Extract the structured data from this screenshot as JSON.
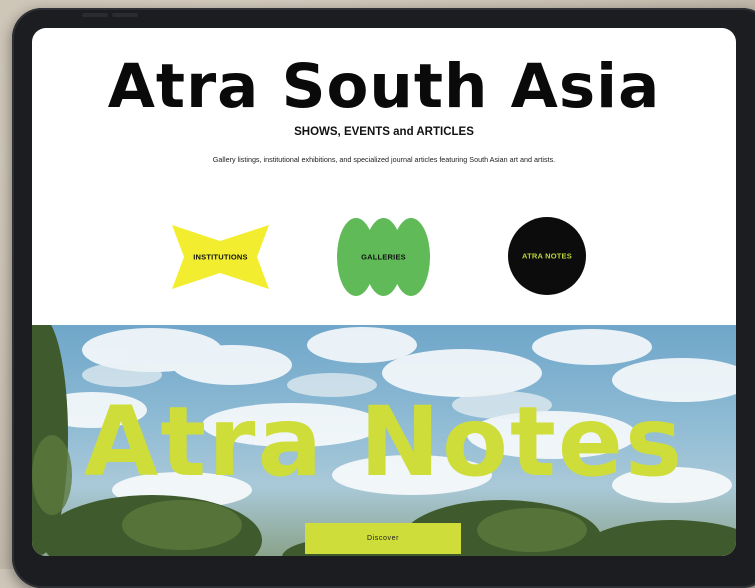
{
  "page": {
    "title": "Atra South Asia",
    "subtitle": "SHOWS, EVENTS and ARTICLES",
    "description": "Gallery listings, institutional exhibitions, and specialized journal articles featuring South Asian art and artists."
  },
  "categories": [
    {
      "label": "INSTITUTIONS",
      "color": "#f2ee2f",
      "text_color": "#111111"
    },
    {
      "label": "GALLERIES",
      "color": "#5fba57",
      "text_color": "#111111"
    },
    {
      "label": "ATRA NOTES",
      "color": "#0c0c0c",
      "text_color": "#bcd63a"
    }
  ],
  "hero": {
    "title": "Atra Notes",
    "button_label": "Discover",
    "accent_color": "#cedd3a"
  }
}
